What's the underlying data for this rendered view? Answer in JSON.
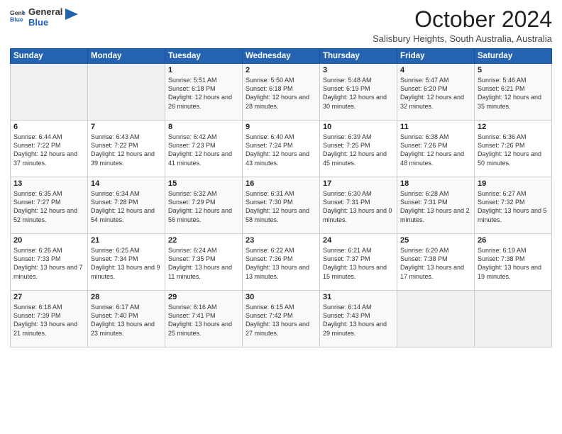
{
  "logo": {
    "line1": "General",
    "line2": "Blue"
  },
  "title": "October 2024",
  "location": "Salisbury Heights, South Australia, Australia",
  "days_of_week": [
    "Sunday",
    "Monday",
    "Tuesday",
    "Wednesday",
    "Thursday",
    "Friday",
    "Saturday"
  ],
  "weeks": [
    [
      {
        "day": "",
        "info": ""
      },
      {
        "day": "",
        "info": ""
      },
      {
        "day": "1",
        "info": "Sunrise: 5:51 AM\nSunset: 6:18 PM\nDaylight: 12 hours and 26 minutes."
      },
      {
        "day": "2",
        "info": "Sunrise: 5:50 AM\nSunset: 6:18 PM\nDaylight: 12 hours and 28 minutes."
      },
      {
        "day": "3",
        "info": "Sunrise: 5:48 AM\nSunset: 6:19 PM\nDaylight: 12 hours and 30 minutes."
      },
      {
        "day": "4",
        "info": "Sunrise: 5:47 AM\nSunset: 6:20 PM\nDaylight: 12 hours and 32 minutes."
      },
      {
        "day": "5",
        "info": "Sunrise: 5:46 AM\nSunset: 6:21 PM\nDaylight: 12 hours and 35 minutes."
      }
    ],
    [
      {
        "day": "6",
        "info": "Sunrise: 6:44 AM\nSunset: 7:22 PM\nDaylight: 12 hours and 37 minutes."
      },
      {
        "day": "7",
        "info": "Sunrise: 6:43 AM\nSunset: 7:22 PM\nDaylight: 12 hours and 39 minutes."
      },
      {
        "day": "8",
        "info": "Sunrise: 6:42 AM\nSunset: 7:23 PM\nDaylight: 12 hours and 41 minutes."
      },
      {
        "day": "9",
        "info": "Sunrise: 6:40 AM\nSunset: 7:24 PM\nDaylight: 12 hours and 43 minutes."
      },
      {
        "day": "10",
        "info": "Sunrise: 6:39 AM\nSunset: 7:25 PM\nDaylight: 12 hours and 45 minutes."
      },
      {
        "day": "11",
        "info": "Sunrise: 6:38 AM\nSunset: 7:26 PM\nDaylight: 12 hours and 48 minutes."
      },
      {
        "day": "12",
        "info": "Sunrise: 6:36 AM\nSunset: 7:26 PM\nDaylight: 12 hours and 50 minutes."
      }
    ],
    [
      {
        "day": "13",
        "info": "Sunrise: 6:35 AM\nSunset: 7:27 PM\nDaylight: 12 hours and 52 minutes."
      },
      {
        "day": "14",
        "info": "Sunrise: 6:34 AM\nSunset: 7:28 PM\nDaylight: 12 hours and 54 minutes."
      },
      {
        "day": "15",
        "info": "Sunrise: 6:32 AM\nSunset: 7:29 PM\nDaylight: 12 hours and 56 minutes."
      },
      {
        "day": "16",
        "info": "Sunrise: 6:31 AM\nSunset: 7:30 PM\nDaylight: 12 hours and 58 minutes."
      },
      {
        "day": "17",
        "info": "Sunrise: 6:30 AM\nSunset: 7:31 PM\nDaylight: 13 hours and 0 minutes."
      },
      {
        "day": "18",
        "info": "Sunrise: 6:28 AM\nSunset: 7:31 PM\nDaylight: 13 hours and 2 minutes."
      },
      {
        "day": "19",
        "info": "Sunrise: 6:27 AM\nSunset: 7:32 PM\nDaylight: 13 hours and 5 minutes."
      }
    ],
    [
      {
        "day": "20",
        "info": "Sunrise: 6:26 AM\nSunset: 7:33 PM\nDaylight: 13 hours and 7 minutes."
      },
      {
        "day": "21",
        "info": "Sunrise: 6:25 AM\nSunset: 7:34 PM\nDaylight: 13 hours and 9 minutes."
      },
      {
        "day": "22",
        "info": "Sunrise: 6:24 AM\nSunset: 7:35 PM\nDaylight: 13 hours and 11 minutes."
      },
      {
        "day": "23",
        "info": "Sunrise: 6:22 AM\nSunset: 7:36 PM\nDaylight: 13 hours and 13 minutes."
      },
      {
        "day": "24",
        "info": "Sunrise: 6:21 AM\nSunset: 7:37 PM\nDaylight: 13 hours and 15 minutes."
      },
      {
        "day": "25",
        "info": "Sunrise: 6:20 AM\nSunset: 7:38 PM\nDaylight: 13 hours and 17 minutes."
      },
      {
        "day": "26",
        "info": "Sunrise: 6:19 AM\nSunset: 7:38 PM\nDaylight: 13 hours and 19 minutes."
      }
    ],
    [
      {
        "day": "27",
        "info": "Sunrise: 6:18 AM\nSunset: 7:39 PM\nDaylight: 13 hours and 21 minutes."
      },
      {
        "day": "28",
        "info": "Sunrise: 6:17 AM\nSunset: 7:40 PM\nDaylight: 13 hours and 23 minutes."
      },
      {
        "day": "29",
        "info": "Sunrise: 6:16 AM\nSunset: 7:41 PM\nDaylight: 13 hours and 25 minutes."
      },
      {
        "day": "30",
        "info": "Sunrise: 6:15 AM\nSunset: 7:42 PM\nDaylight: 13 hours and 27 minutes."
      },
      {
        "day": "31",
        "info": "Sunrise: 6:14 AM\nSunset: 7:43 PM\nDaylight: 13 hours and 29 minutes."
      },
      {
        "day": "",
        "info": ""
      },
      {
        "day": "",
        "info": ""
      }
    ]
  ]
}
